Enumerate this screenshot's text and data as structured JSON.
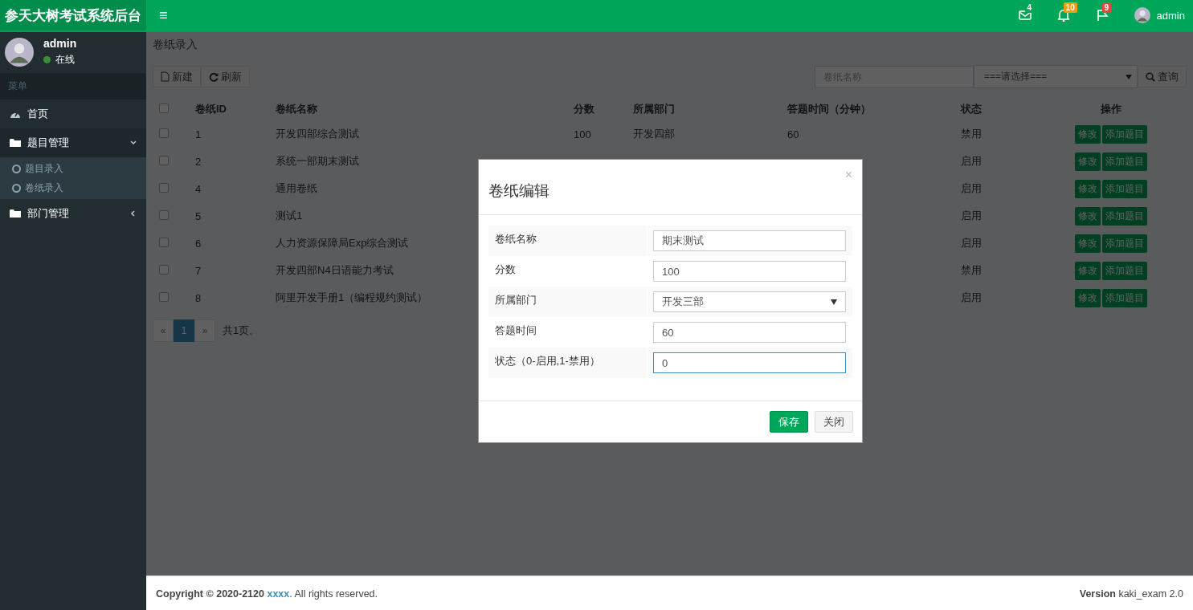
{
  "header": {
    "logo": "参天大树考试系统后台",
    "menu_toggle": "≡",
    "notifications": [
      {
        "kind": "mail",
        "count": "4",
        "color": "#00a65a"
      },
      {
        "kind": "bell",
        "count": "10",
        "color": "#f39c12"
      },
      {
        "kind": "flag",
        "count": "9",
        "color": "#dd4b39"
      }
    ],
    "user": "admin"
  },
  "sidebar": {
    "user": {
      "name": "admin",
      "status": "在线"
    },
    "menu_header": "菜单",
    "items": [
      {
        "kind": "dashboard",
        "label": "首页"
      },
      {
        "kind": "folder",
        "label": "题目管理",
        "expanded": true,
        "children": [
          {
            "label": "题目录入"
          },
          {
            "label": "卷纸录入"
          }
        ]
      },
      {
        "kind": "folder",
        "label": "部门管理",
        "expanded": false
      }
    ]
  },
  "content": {
    "title": "卷纸录入",
    "toolbar": [
      {
        "kind": "new",
        "label": "新建"
      },
      {
        "kind": "refresh",
        "label": "刷新"
      }
    ],
    "search": {
      "placeholder": "卷纸名称",
      "select": "===请选择===",
      "button": "查询"
    },
    "table": {
      "select_all": {
        "checked": false
      },
      "columns": [
        "卷纸ID",
        "卷纸名称",
        "分数",
        "所属部门",
        "答题时间（分钟）",
        "状态",
        "操作"
      ],
      "rows": [
        {
          "checked": false,
          "id": "1",
          "name": "开发四部综合测试",
          "score": "100",
          "department": "开发四部",
          "time": "60",
          "status": "禁用",
          "actions": [
            "修改",
            "添加题目"
          ]
        },
        {
          "checked": false,
          "id": "2",
          "name": "系统一部期末测试",
          "status": "启用",
          "actions": [
            "修改",
            "添加题目"
          ]
        },
        {
          "checked": false,
          "id": "4",
          "name": "通用卷纸",
          "status": "启用",
          "actions": [
            "修改",
            "添加题目"
          ]
        },
        {
          "checked": false,
          "id": "5",
          "name": "测试1",
          "status": "启用",
          "actions": [
            "修改",
            "添加题目"
          ]
        },
        {
          "checked": false,
          "id": "6",
          "name": "人力资源保障局Exp综合测试",
          "status": "启用",
          "actions": [
            "修改",
            "添加题目"
          ]
        },
        {
          "checked": false,
          "id": "7",
          "name": "开发四部N4日语能力考试",
          "status": "禁用",
          "actions": [
            "修改",
            "添加题目"
          ]
        },
        {
          "checked": false,
          "id": "8",
          "name": "阿里开发手册1（编程规约测试）",
          "status": "启用",
          "actions": [
            "修改",
            "添加题目"
          ]
        }
      ]
    },
    "pagination": {
      "prev": "«",
      "pages": [
        {
          "label": "1",
          "selected": true
        }
      ],
      "next": "»",
      "summary": "共1页。"
    }
  },
  "modal": {
    "title": "卷纸编辑",
    "close": "×",
    "fields": [
      {
        "kind": "text",
        "label": "卷纸名称",
        "value": "期末测试",
        "focused": false
      },
      {
        "kind": "text",
        "label": "分数",
        "value": "100",
        "focused": false
      },
      {
        "kind": "select",
        "label": "所属部门",
        "value": "开发三部",
        "focused": false
      },
      {
        "kind": "text",
        "label": "答题时间",
        "value": "60",
        "focused": false
      },
      {
        "kind": "text",
        "label": "状态（0-启用,1-禁用）",
        "value": "0",
        "focused": true
      }
    ],
    "buttons": [
      {
        "kind": "primary",
        "label": "保存"
      },
      {
        "kind": "default",
        "label": "关闭"
      }
    ]
  },
  "footer": {
    "copyright": "Copyright © 2020-2120",
    "link": "xxxx",
    "rest": ". All rights reserved.",
    "version": "**Version** kaki_exam 2.0"
  }
}
